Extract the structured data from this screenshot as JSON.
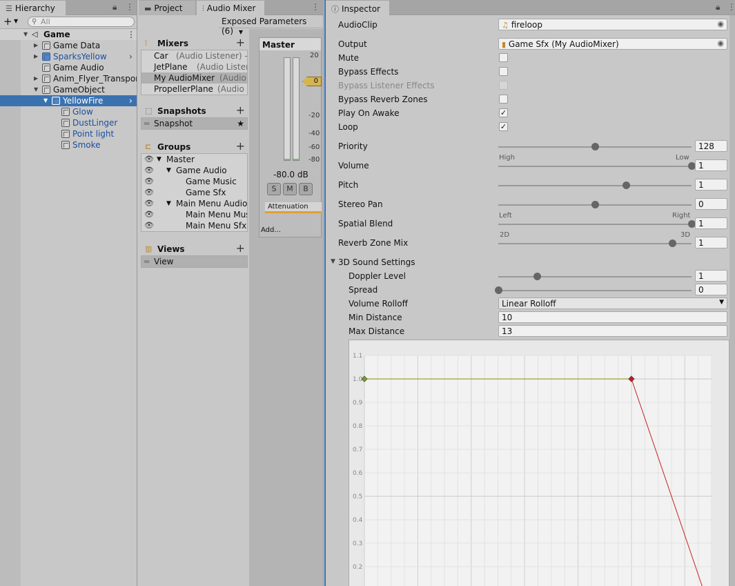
{
  "hierarchy": {
    "tab_label": "Hierarchy",
    "search_placeholder": "All",
    "rows": [
      {
        "label": "Game"
      },
      {
        "label": "Game Data"
      },
      {
        "label": "SparksYellow"
      },
      {
        "label": "Game Audio"
      },
      {
        "label": "Anim_Flyer_Transport"
      },
      {
        "label": "GameObject"
      },
      {
        "label": "YellowFire"
      },
      {
        "label": "Glow"
      },
      {
        "label": "DustLinger"
      },
      {
        "label": "Point light"
      },
      {
        "label": "Smoke"
      }
    ]
  },
  "mixer": {
    "tabs": {
      "project": "Project",
      "audio_mixer": "Audio Mixer"
    },
    "exposed_params": "Exposed Parameters (6)",
    "mixers_header": "Mixers",
    "mixers": [
      {
        "name": "Car",
        "detail": "(Audio Listener) - I"
      },
      {
        "name": "JetPlane",
        "detail": "(Audio Listen"
      },
      {
        "name": "My AudioMixer",
        "detail": "(Audio"
      },
      {
        "name": "PropellerPlane",
        "detail": "(Audio I"
      }
    ],
    "snapshots_header": "Snapshots",
    "snapshot": "Snapshot",
    "groups_header": "Groups",
    "groups": [
      {
        "label": "Master"
      },
      {
        "label": "Game Audio"
      },
      {
        "label": "Game Music"
      },
      {
        "label": "Game Sfx"
      },
      {
        "label": "Main Menu Audio"
      },
      {
        "label": "Main Menu Mus"
      },
      {
        "label": "Main Menu Sfx"
      }
    ],
    "views_header": "Views",
    "view": "View",
    "strip": {
      "title": "Master",
      "db": "-80.0 dB",
      "fader_value": "0",
      "scale": [
        "20",
        "-20",
        "-40",
        "-60",
        "-80"
      ],
      "solo": "S",
      "mute": "M",
      "bypass": "B",
      "attenuation": "Attenuation",
      "add": "Add..."
    }
  },
  "inspector": {
    "tab_label": "Inspector",
    "audioclip_label": "AudioClip",
    "audioclip_value": "fireloop",
    "output_label": "Output",
    "output_value": "Game Sfx (My AudioMixer)",
    "toggles": [
      {
        "label": "Mute",
        "checked": false
      },
      {
        "label": "Bypass Effects",
        "checked": false
      },
      {
        "label": "Bypass Listener Effects",
        "checked": false
      },
      {
        "label": "Bypass Reverb Zones",
        "checked": false
      },
      {
        "label": "Play On Awake",
        "checked": true
      },
      {
        "label": "Loop",
        "checked": true
      }
    ],
    "sliders": [
      {
        "label": "Priority",
        "value": "128",
        "fraction": 0.5,
        "min_label": "High",
        "max_label": "Low"
      },
      {
        "label": "Volume",
        "value": "1",
        "fraction": 1.0
      },
      {
        "label": "Pitch",
        "value": "1",
        "fraction": 0.66
      },
      {
        "label": "Stereo Pan",
        "value": "0",
        "fraction": 0.5,
        "min_label": "Left",
        "max_label": "Right"
      },
      {
        "label": "Spatial Blend",
        "value": "1",
        "fraction": 1.0,
        "min_label": "2D",
        "max_label": "3D"
      },
      {
        "label": "Reverb Zone Mix",
        "value": "1",
        "fraction": 0.9
      }
    ],
    "sound3d_header": "3D Sound Settings",
    "doppler": {
      "label": "Doppler Level",
      "value": "1",
      "fraction": 0.2
    },
    "spread": {
      "label": "Spread",
      "value": "0",
      "fraction": 0.0
    },
    "rolloff": {
      "label": "Volume Rolloff",
      "value": "Linear Rolloff"
    },
    "min_distance": {
      "label": "Min Distance",
      "value": "10"
    },
    "max_distance": {
      "label": "Max Distance",
      "value": "13"
    }
  },
  "chart_data": {
    "type": "line",
    "y_ticks": [
      "1.1",
      "1.0",
      "0.9",
      "0.8",
      "0.7",
      "0.6",
      "0.5",
      "0.4",
      "0.3",
      "0.2"
    ],
    "ylim": [
      0.15,
      1.1
    ],
    "xlim": [
      0,
      13
    ],
    "series": [
      {
        "color": "#8a8a10",
        "points": [
          [
            0,
            1.0
          ],
          [
            10,
            1.0
          ]
        ]
      },
      {
        "color": "#c82020",
        "points": [
          [
            10,
            1.0
          ],
          [
            13,
            0.0
          ]
        ]
      }
    ]
  }
}
